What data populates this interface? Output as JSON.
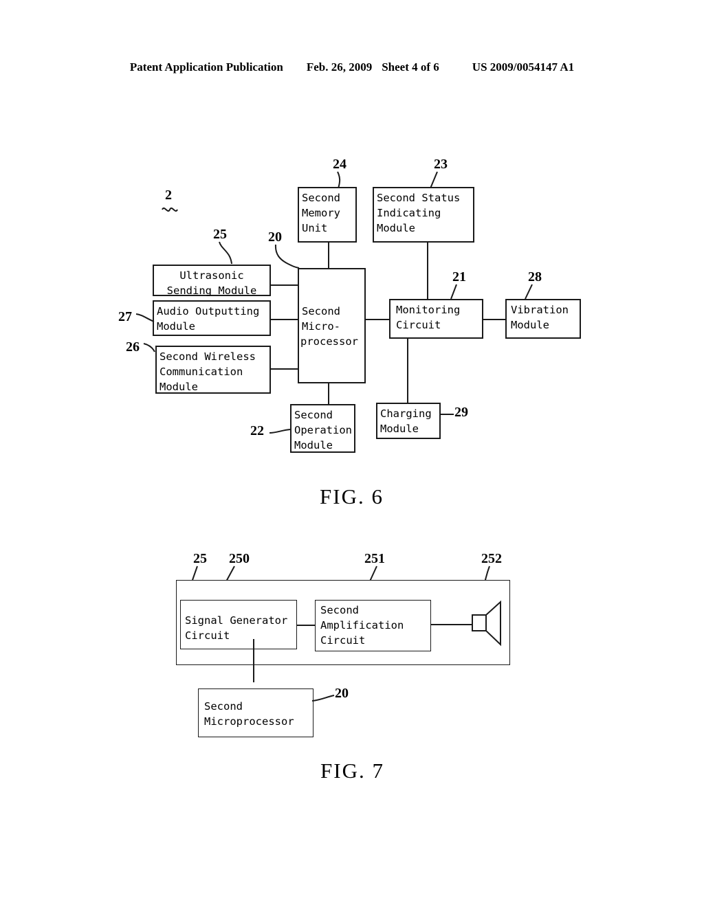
{
  "header": {
    "publication": "Patent Application Publication",
    "date": "Feb. 26, 2009",
    "sheet": "Sheet 4 of 6",
    "docnumber": "US 2009/0054147 A1"
  },
  "fig6": {
    "caption": "FIG. 6",
    "system_ref": "2",
    "boxes": {
      "second_memory_unit": {
        "ref": "24",
        "line1": "Second",
        "line2": "Memory",
        "line3": "Unit"
      },
      "second_status_indicating_module": {
        "ref": "23",
        "line1": "Second Status",
        "line2": "Indicating",
        "line3": "Module"
      },
      "ultrasonic_sending_module": {
        "ref": "25",
        "line1": "Ultrasonic",
        "line2": "Sending Module"
      },
      "audio_outputting_module": {
        "ref": "27",
        "line1": "Audio Outputting",
        "line2": "Module"
      },
      "second_wireless_communication_module": {
        "ref": "26",
        "line1": "Second Wireless",
        "line2": "Communication",
        "line3": "Module"
      },
      "second_microprocessor": {
        "ref": "20",
        "line1": "Second",
        "line2": "Micro-",
        "line3": "processor"
      },
      "monitoring_circuit": {
        "ref": "21",
        "line1": "Monitoring",
        "line2": "Circuit"
      },
      "vibration_module": {
        "ref": "28",
        "line1": "Vibration",
        "line2": "Module"
      },
      "second_operation_module": {
        "ref": "22",
        "line1": "Second",
        "line2": "Operation",
        "line3": "Module"
      },
      "charging_module": {
        "ref": "29",
        "line1": "Charging",
        "line2": "Module"
      }
    }
  },
  "fig7": {
    "caption": "FIG. 7",
    "boxes": {
      "ultrasonic_sending_module_outer": {
        "ref": "25"
      },
      "signal_generator_circuit": {
        "ref": "250",
        "line1": "Signal Generator",
        "line2": "Circuit"
      },
      "second_amplification_circuit": {
        "ref": "251",
        "line1": "Second",
        "line2": "Amplification",
        "line3": "Circuit"
      },
      "speaker": {
        "ref": "252"
      },
      "second_microprocessor": {
        "ref": "20",
        "line1": "Second",
        "line2": "Microprocessor"
      }
    }
  },
  "colors": {
    "ink": "#1a1a1a",
    "paper": "#ffffff"
  }
}
